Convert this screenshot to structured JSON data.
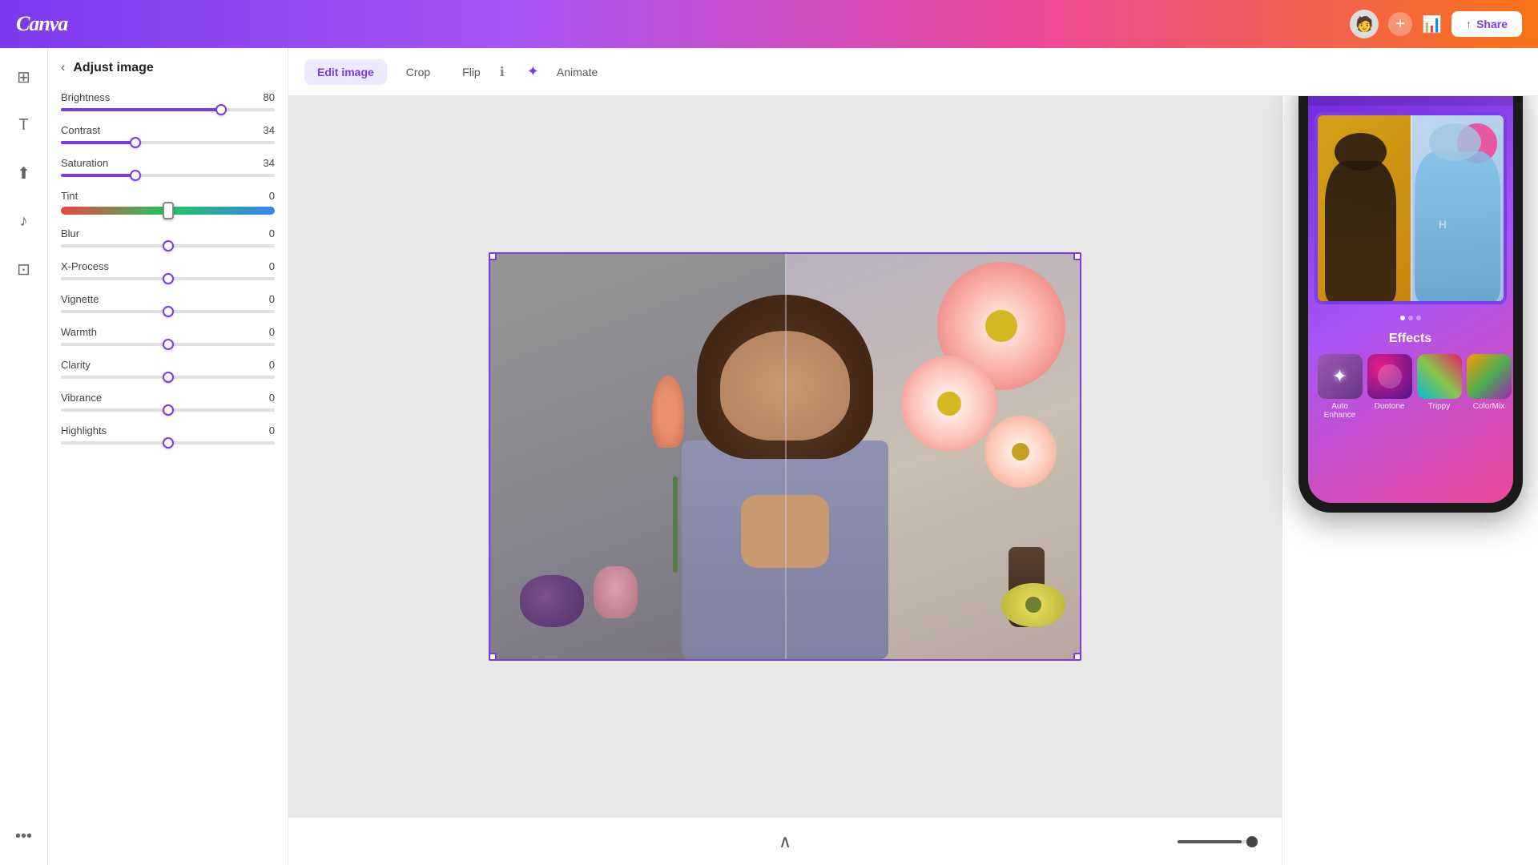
{
  "header": {
    "logo": "Canva",
    "share_label": "Share",
    "share_icon": "↑"
  },
  "sidebar_icons": [
    {
      "name": "grid-icon",
      "symbol": "⊞"
    },
    {
      "name": "text-icon",
      "symbol": "T"
    },
    {
      "name": "upload-icon",
      "symbol": "↑"
    },
    {
      "name": "music-icon",
      "symbol": "♪"
    },
    {
      "name": "image-frame-icon",
      "symbol": "⊡"
    },
    {
      "name": "more-icon",
      "symbol": "•••"
    }
  ],
  "adjust_panel": {
    "title": "Adjust image",
    "sliders": [
      {
        "label": "Brightness",
        "value": 80,
        "min": 0,
        "max": 100,
        "fill_pct": 75
      },
      {
        "label": "Contrast",
        "value": 34,
        "min": 0,
        "max": 100,
        "fill_pct": 35
      },
      {
        "label": "Saturation",
        "value": 34,
        "min": 0,
        "max": 100,
        "fill_pct": 35
      },
      {
        "label": "Tint",
        "value": 0,
        "min": -100,
        "max": 100,
        "fill_pct": 50,
        "special": true
      },
      {
        "label": "Blur",
        "value": 0,
        "min": 0,
        "max": 100,
        "fill_pct": 50
      },
      {
        "label": "X-Process",
        "value": 0,
        "min": 0,
        "max": 100,
        "fill_pct": 50
      },
      {
        "label": "Vignette",
        "value": 0,
        "min": 0,
        "max": 100,
        "fill_pct": 50
      },
      {
        "label": "Warmth",
        "value": 0,
        "min": 0,
        "max": 100,
        "fill_pct": 50
      },
      {
        "label": "Clarity",
        "value": 0,
        "min": 0,
        "max": 100,
        "fill_pct": 50
      },
      {
        "label": "Vibrance",
        "value": 0,
        "min": 0,
        "max": 100,
        "fill_pct": 50
      },
      {
        "label": "Highlights",
        "value": 0,
        "min": 0,
        "max": 100,
        "fill_pct": 50
      }
    ]
  },
  "toolbar": {
    "buttons": [
      {
        "label": "Edit image",
        "active": true
      },
      {
        "label": "Crop",
        "active": false
      },
      {
        "label": "Flip",
        "active": false
      }
    ],
    "info_icon": "ℹ",
    "animate_label": "Animate",
    "animate_icon": "✦"
  },
  "phone": {
    "effects_title": "Effects",
    "effects": [
      {
        "label": "Auto Enhance",
        "class": "auto-enhance-bg"
      },
      {
        "label": "Duotone",
        "class": "duotone-bg"
      },
      {
        "label": "Trippy",
        "class": "trippy-bg"
      },
      {
        "label": "ColorMix",
        "class": "colormix-bg"
      }
    ]
  }
}
